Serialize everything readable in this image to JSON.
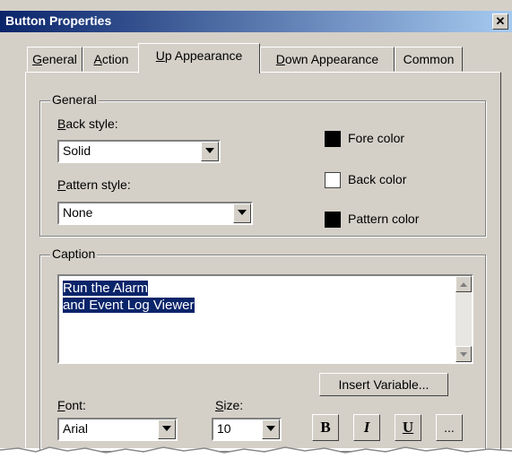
{
  "window": {
    "title": "Button Properties",
    "close_glyph": "✕"
  },
  "tabs": [
    {
      "key": "G",
      "rest": "eneral"
    },
    {
      "key": "A",
      "rest": "ction"
    },
    {
      "key": "U",
      "rest": "p Appearance"
    },
    {
      "key": "D",
      "rest": "own Appearance"
    },
    {
      "key": "",
      "rest": "Common"
    }
  ],
  "general": {
    "legend": "General",
    "back_style": {
      "key": "B",
      "rest": "ack style:",
      "value": "Solid"
    },
    "pattern_style": {
      "key": "P",
      "rest": "attern style:",
      "value": "None"
    },
    "fore_color": {
      "label": "Fore color",
      "color": "#000000"
    },
    "back_color": {
      "label": "Back color",
      "color": "#ffffff"
    },
    "pattern_color": {
      "label": "Pattern color",
      "color": "#000000"
    }
  },
  "caption": {
    "legend": "Caption",
    "line1": "Run the Alarm",
    "line2": "and Event Log Viewer",
    "insert_variable": "Insert Variable...",
    "font": {
      "key": "F",
      "rest": "ont:",
      "value": "Arial"
    },
    "size": {
      "key": "S",
      "rest": "ize:",
      "value": "10"
    },
    "bold": "B",
    "italic": "I",
    "underline": "U",
    "more": "..."
  }
}
